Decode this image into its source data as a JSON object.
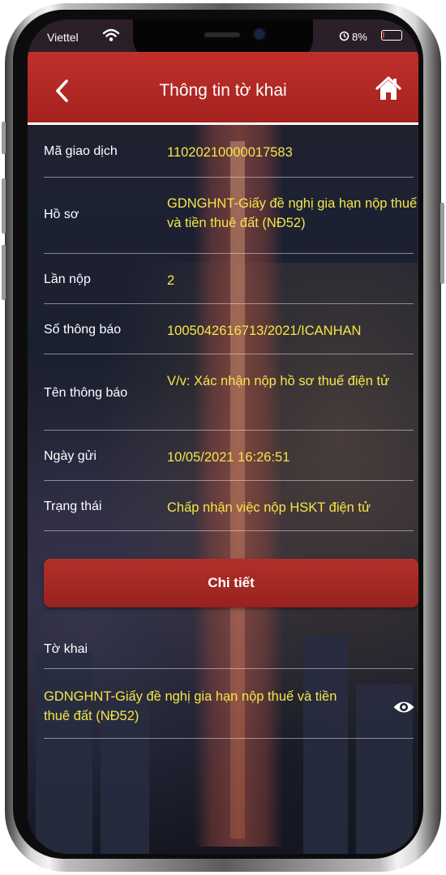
{
  "status_bar": {
    "carrier": "Viettel",
    "battery": "8%",
    "battery_level": 0.08,
    "icons": [
      "wifi-icon",
      "alarm-icon",
      "battery-icon"
    ]
  },
  "nav": {
    "title": "Thông tin tờ khai",
    "back_icon": "chevron-left-icon",
    "home_icon": "home-icon"
  },
  "fields": [
    {
      "label": "Mã giao dịch",
      "value": "11020210000017583"
    },
    {
      "label": "Hồ sơ",
      "value": "GDNGHNT-Giấy đề nghị gia hạn nộp thuế và tiền thuê đất (NĐ52)"
    },
    {
      "label": "Lần nộp",
      "value": "2"
    },
    {
      "label": "Số thông báo",
      "value": "1005042616713/2021/ICANHAN"
    },
    {
      "label": "Tên thông báo",
      "value": "V/v: Xác nhận nộp hồ sơ thuế điện tử"
    },
    {
      "label": "Ngày gửi",
      "value": "10/05/2021 16:26:51"
    },
    {
      "label": "Trạng thái",
      "value": "Chấp nhận việc nộp HSKT điện tử"
    }
  ],
  "detail_button": {
    "label": "Chi tiết"
  },
  "declaration": {
    "label": "Tờ khai",
    "file": "GDNGHNT-Giấy đề nghị gia hạn nộp thuế và tiền thuê đất (NĐ52)",
    "view_icon": "eye-icon"
  },
  "colors": {
    "accent_red": "#b2302a",
    "value_yellow": "#f5e64a",
    "text_white": "#ffffff"
  }
}
